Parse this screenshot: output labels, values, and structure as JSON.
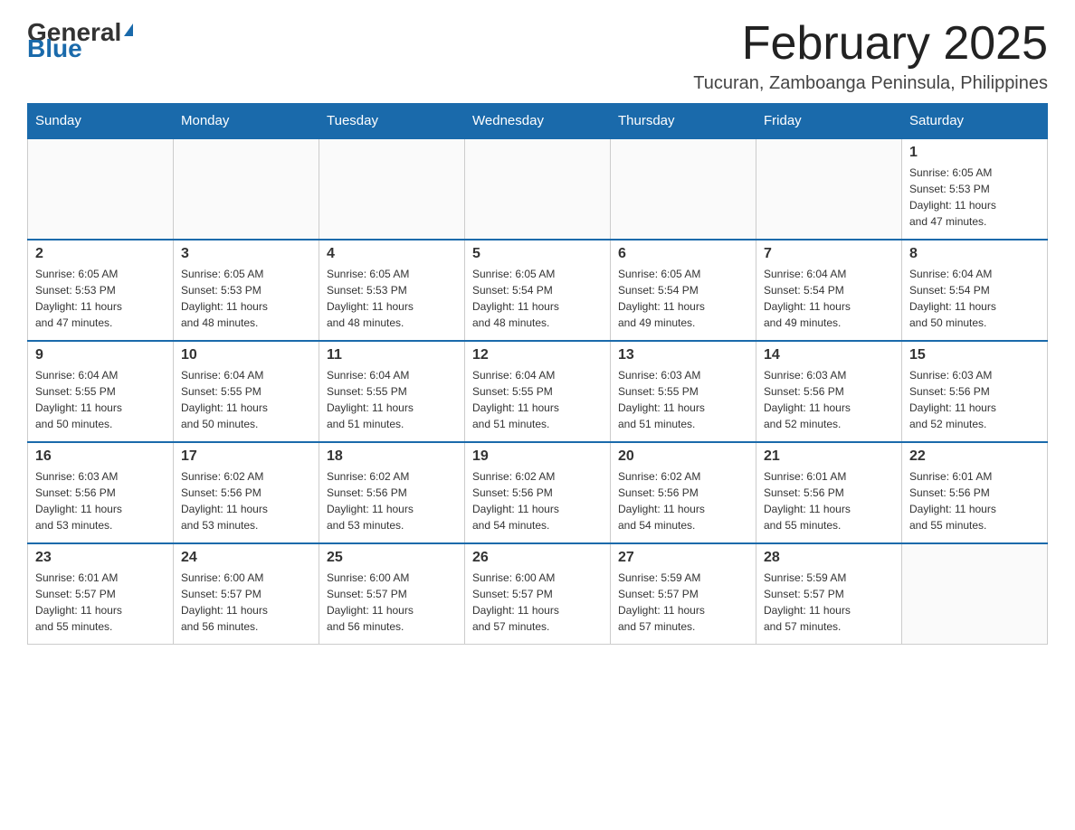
{
  "header": {
    "logo_general": "General",
    "logo_blue": "Blue",
    "month_year": "February 2025",
    "location": "Tucuran, Zamboanga Peninsula, Philippines"
  },
  "days_of_week": [
    "Sunday",
    "Monday",
    "Tuesday",
    "Wednesday",
    "Thursday",
    "Friday",
    "Saturday"
  ],
  "weeks": [
    [
      {
        "day": "",
        "info": ""
      },
      {
        "day": "",
        "info": ""
      },
      {
        "day": "",
        "info": ""
      },
      {
        "day": "",
        "info": ""
      },
      {
        "day": "",
        "info": ""
      },
      {
        "day": "",
        "info": ""
      },
      {
        "day": "1",
        "info": "Sunrise: 6:05 AM\nSunset: 5:53 PM\nDaylight: 11 hours\nand 47 minutes."
      }
    ],
    [
      {
        "day": "2",
        "info": "Sunrise: 6:05 AM\nSunset: 5:53 PM\nDaylight: 11 hours\nand 47 minutes."
      },
      {
        "day": "3",
        "info": "Sunrise: 6:05 AM\nSunset: 5:53 PM\nDaylight: 11 hours\nand 48 minutes."
      },
      {
        "day": "4",
        "info": "Sunrise: 6:05 AM\nSunset: 5:53 PM\nDaylight: 11 hours\nand 48 minutes."
      },
      {
        "day": "5",
        "info": "Sunrise: 6:05 AM\nSunset: 5:54 PM\nDaylight: 11 hours\nand 48 minutes."
      },
      {
        "day": "6",
        "info": "Sunrise: 6:05 AM\nSunset: 5:54 PM\nDaylight: 11 hours\nand 49 minutes."
      },
      {
        "day": "7",
        "info": "Sunrise: 6:04 AM\nSunset: 5:54 PM\nDaylight: 11 hours\nand 49 minutes."
      },
      {
        "day": "8",
        "info": "Sunrise: 6:04 AM\nSunset: 5:54 PM\nDaylight: 11 hours\nand 50 minutes."
      }
    ],
    [
      {
        "day": "9",
        "info": "Sunrise: 6:04 AM\nSunset: 5:55 PM\nDaylight: 11 hours\nand 50 minutes."
      },
      {
        "day": "10",
        "info": "Sunrise: 6:04 AM\nSunset: 5:55 PM\nDaylight: 11 hours\nand 50 minutes."
      },
      {
        "day": "11",
        "info": "Sunrise: 6:04 AM\nSunset: 5:55 PM\nDaylight: 11 hours\nand 51 minutes."
      },
      {
        "day": "12",
        "info": "Sunrise: 6:04 AM\nSunset: 5:55 PM\nDaylight: 11 hours\nand 51 minutes."
      },
      {
        "day": "13",
        "info": "Sunrise: 6:03 AM\nSunset: 5:55 PM\nDaylight: 11 hours\nand 51 minutes."
      },
      {
        "day": "14",
        "info": "Sunrise: 6:03 AM\nSunset: 5:56 PM\nDaylight: 11 hours\nand 52 minutes."
      },
      {
        "day": "15",
        "info": "Sunrise: 6:03 AM\nSunset: 5:56 PM\nDaylight: 11 hours\nand 52 minutes."
      }
    ],
    [
      {
        "day": "16",
        "info": "Sunrise: 6:03 AM\nSunset: 5:56 PM\nDaylight: 11 hours\nand 53 minutes."
      },
      {
        "day": "17",
        "info": "Sunrise: 6:02 AM\nSunset: 5:56 PM\nDaylight: 11 hours\nand 53 minutes."
      },
      {
        "day": "18",
        "info": "Sunrise: 6:02 AM\nSunset: 5:56 PM\nDaylight: 11 hours\nand 53 minutes."
      },
      {
        "day": "19",
        "info": "Sunrise: 6:02 AM\nSunset: 5:56 PM\nDaylight: 11 hours\nand 54 minutes."
      },
      {
        "day": "20",
        "info": "Sunrise: 6:02 AM\nSunset: 5:56 PM\nDaylight: 11 hours\nand 54 minutes."
      },
      {
        "day": "21",
        "info": "Sunrise: 6:01 AM\nSunset: 5:56 PM\nDaylight: 11 hours\nand 55 minutes."
      },
      {
        "day": "22",
        "info": "Sunrise: 6:01 AM\nSunset: 5:56 PM\nDaylight: 11 hours\nand 55 minutes."
      }
    ],
    [
      {
        "day": "23",
        "info": "Sunrise: 6:01 AM\nSunset: 5:57 PM\nDaylight: 11 hours\nand 55 minutes."
      },
      {
        "day": "24",
        "info": "Sunrise: 6:00 AM\nSunset: 5:57 PM\nDaylight: 11 hours\nand 56 minutes."
      },
      {
        "day": "25",
        "info": "Sunrise: 6:00 AM\nSunset: 5:57 PM\nDaylight: 11 hours\nand 56 minutes."
      },
      {
        "day": "26",
        "info": "Sunrise: 6:00 AM\nSunset: 5:57 PM\nDaylight: 11 hours\nand 57 minutes."
      },
      {
        "day": "27",
        "info": "Sunrise: 5:59 AM\nSunset: 5:57 PM\nDaylight: 11 hours\nand 57 minutes."
      },
      {
        "day": "28",
        "info": "Sunrise: 5:59 AM\nSunset: 5:57 PM\nDaylight: 11 hours\nand 57 minutes."
      },
      {
        "day": "",
        "info": ""
      }
    ]
  ]
}
